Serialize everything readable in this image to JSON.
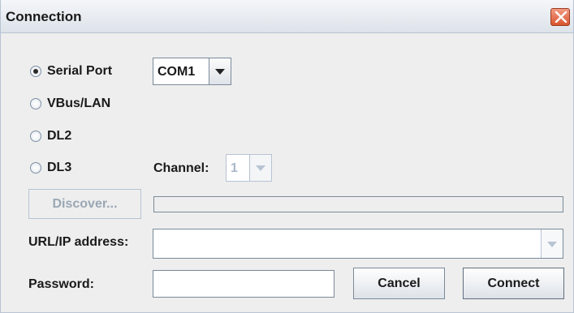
{
  "window": {
    "title": "Connection"
  },
  "connection_type": {
    "options": [
      {
        "label": "Serial Port",
        "selected": true
      },
      {
        "label": "VBus/LAN",
        "selected": false
      },
      {
        "label": "DL2",
        "selected": false
      },
      {
        "label": "DL3",
        "selected": false
      }
    ]
  },
  "serial_port": {
    "value": "COM1"
  },
  "channel": {
    "label": "Channel:",
    "value": "1",
    "enabled": false
  },
  "discover": {
    "label": "Discover...",
    "enabled": false,
    "progress": 0
  },
  "url": {
    "label": "URL/IP address:",
    "value": ""
  },
  "password": {
    "label": "Password:",
    "value": ""
  },
  "buttons": {
    "cancel": "Cancel",
    "connect": "Connect"
  },
  "icons": {
    "close": "close-icon",
    "dropdown": "chevron-down-icon",
    "radio": "radio-icon"
  },
  "colors": {
    "close_button": "#d9532e",
    "background": "#eeeeee",
    "disabled_text": "#a9b8c8"
  }
}
